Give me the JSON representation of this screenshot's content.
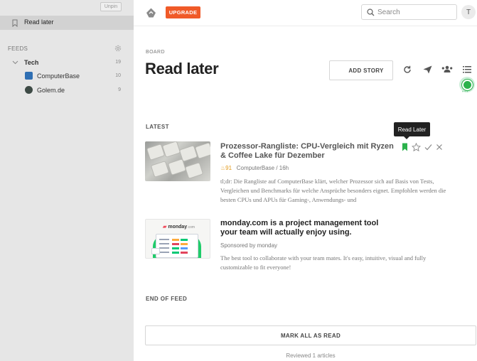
{
  "sidebar": {
    "unpin_label": "Unpin",
    "read_later_label": "Read later",
    "feeds_header": "FEEDS",
    "category": {
      "label": "Tech",
      "count": "19"
    },
    "feeds": [
      {
        "label": "ComputerBase",
        "count": "10",
        "icon": "computerbase-favicon",
        "color": "#2f6fb3"
      },
      {
        "label": "Golem.de",
        "count": "9",
        "icon": "golem-favicon",
        "color": "#3d4a45"
      }
    ]
  },
  "topbar": {
    "upgrade_label": "UPGRADE",
    "search_placeholder": "Search",
    "avatar_initial": "T"
  },
  "board": {
    "eyebrow": "BOARD",
    "title": "Read later",
    "add_story_label": "ADD STORY",
    "tooltip": "Read Later"
  },
  "feed": {
    "section_label": "LATEST",
    "stories": [
      {
        "title": "Prozessor-Rangliste: CPU-Vergleich mit Ryzen & Coffee Lake für Dezember",
        "votes": "♨91",
        "source": "ComputerBase / 16h",
        "summary": "tl;dr: Die Rangliste auf ComputerBase klärt, welcher Prozessor sich auf Basis von Tests, Vergleichen und Benchmarks für welche Ansprüche besonders eignet. Empfohlen werden die besten CPUs und APUs für Gaming-, Anwendungs- und"
      },
      {
        "title": "monday.com is a project management tool your team will actually enjoy using.",
        "source": "Sponsored by monday",
        "summary": "The best tool to collaborate with your team mates. It's easy, intuitive, visual and fully customizable to fit everyone!",
        "thumb_brand": "monday",
        "thumb_brand_suffix": ".com"
      }
    ],
    "end_label": "END OF FEED",
    "mark_all_label": "MARK ALL AS READ",
    "reviewed_text": "Reviewed 1 articles"
  },
  "colors": {
    "accent": "#f05a28",
    "green": "#2bb24c",
    "sidebar_bg": "#e6e6e6"
  }
}
